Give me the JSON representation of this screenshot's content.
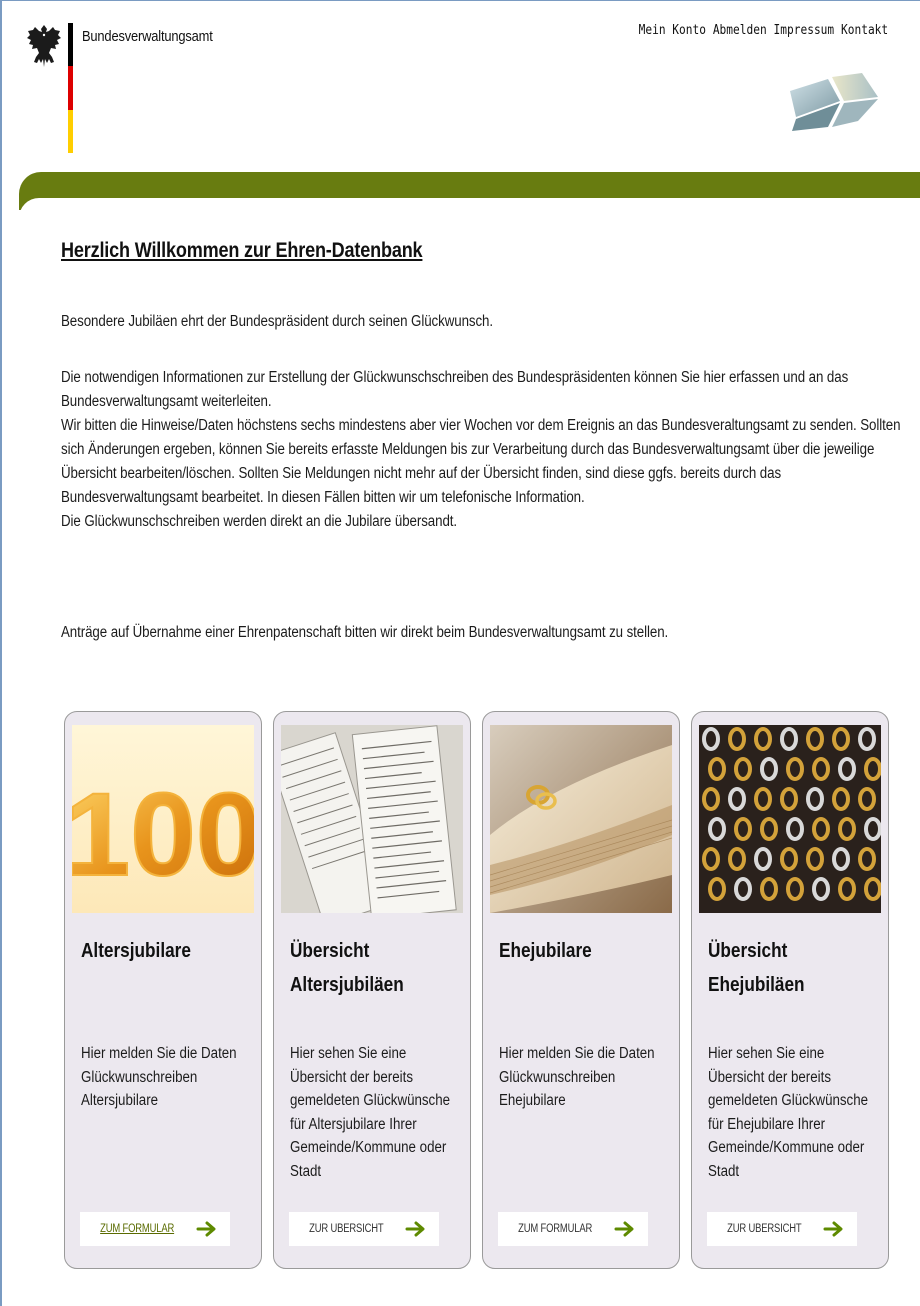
{
  "header": {
    "agency_name": "Bundesverwaltungsamt",
    "nav": {
      "account": "Mein Konto",
      "logout": "Abmelden",
      "imprint": "Impressum",
      "contact": "Kontakt"
    }
  },
  "main": {
    "title": "Herzlich Willkommen zur Ehren-Datenbank",
    "paragraph1": "Besondere Jubiläen ehrt der Bundespräsident durch seinen Glückwunsch.",
    "paragraph2": "Die notwendigen Informationen zur Erstellung der Glückwunschschreiben des Bundespräsidenten können Sie hier erfassen und an das Bundesverwaltungsamt weiterleiten.\nWir bitten die Hinweise/Daten höchstens sechs mindestens aber vier Wochen vor dem Ereignis an das Bundesveraltungsamt zu senden. Sollten sich Änderungen ergeben, können Sie bereits erfasste Meldungen bis zur Verarbeitung durch das Bundesverwaltungsamt über die jeweilige Übersicht bearbeiten/löschen. Sollten Sie Meldungen nicht mehr auf der Übersicht finden, sind diese ggfs. bereits durch das Bundesverwaltungsamt bearbeitet. In diesen Fällen bitten wir um telefonische Information.\nDie Glückwunschschreiben werden direkt an die Jubilare übersandt.",
    "paragraph3": "Anträge auf Übernahme einer Ehrenpatenschaft bitten wir direkt beim Bundesverwaltungsamt zu stellen."
  },
  "cards": [
    {
      "title": "Altersjubilare",
      "description": "Hier melden Sie die Daten Glückwunschreiben Altersjubilare",
      "button": "ZUM FORMULAR",
      "image_text": "100"
    },
    {
      "title": "Übersicht Altersjubiläen",
      "description": "Hier sehen Sie eine Übersicht der bereits gemeldeten Glückwünsche für Altersjubilare Ihrer Gemeinde/Kommune oder Stadt",
      "button": "ZUR ÜBERSICHT"
    },
    {
      "title": "Ehejubilare",
      "description": "Hier melden Sie die Daten Glückwunschreiben Ehejubilare",
      "button": "ZUM FORMULAR"
    },
    {
      "title": "Übersicht Ehejubiläen",
      "description": "Hier sehen Sie eine Übersicht der bereits gemeldeten Glückwünsche für Ehejubilare Ihrer Gemeinde/Kommune oder Stadt",
      "button": "ZUR ÜBERSICHT"
    }
  ],
  "colors": {
    "band_green": "#687c10",
    "arrow_green": "#5e8a00",
    "card_bg": "#ece8ef",
    "flag_black": "#000000",
    "flag_red": "#dd0000",
    "flag_gold": "#ffce00"
  },
  "icons": [
    "federal-eagle-icon",
    "arrow-right-icon"
  ]
}
